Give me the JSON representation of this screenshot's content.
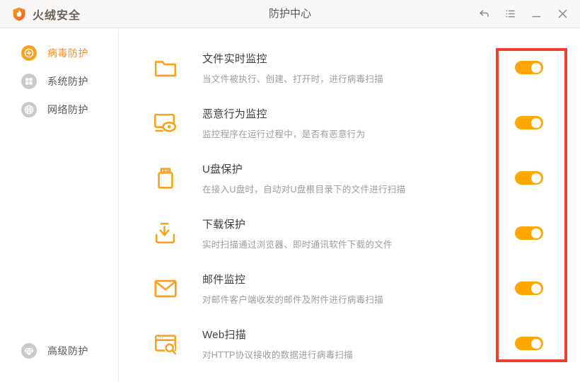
{
  "window": {
    "brand": "火绒安全",
    "title": "防护中心"
  },
  "titlebar": {
    "icons": [
      "undo-icon",
      "menu-list-icon",
      "minimize-icon",
      "close-icon"
    ]
  },
  "sidebar": {
    "items": [
      {
        "label": "病毒防护",
        "icon": "virus-protection-icon",
        "active": true
      },
      {
        "label": "系统防护",
        "icon": "system-protection-icon",
        "active": false
      },
      {
        "label": "网络防护",
        "icon": "network-protection-icon",
        "active": false
      }
    ],
    "bottom_item": {
      "label": "高级防护",
      "icon": "advanced-protection-icon",
      "active": false
    }
  },
  "main": {
    "rows": [
      {
        "icon": "folder-icon",
        "title": "文件实时监控",
        "desc": "当文件被执行、创建、打开时，进行病毒扫描",
        "toggle": "on"
      },
      {
        "icon": "behavior-monitor-icon",
        "title": "恶意行为监控",
        "desc": "监控程序在运行过程中，是否有恶意行为",
        "toggle": "on"
      },
      {
        "icon": "usb-drive-icon",
        "title": "U盘保护",
        "desc": "在接入U盘时，自动对U盘根目录下的文件进行扫描",
        "toggle": "on"
      },
      {
        "icon": "download-icon",
        "title": "下载保护",
        "desc": "实时扫描通过浏览器、即时通讯软件下载的文件",
        "toggle": "on"
      },
      {
        "icon": "mail-icon",
        "title": "邮件监控",
        "desc": "对邮件客户端收发的邮件及附件进行病毒扫描",
        "toggle": "on"
      },
      {
        "icon": "web-scan-icon",
        "title": "Web扫描",
        "desc": "对HTTP协议接收的数据进行病毒扫描",
        "toggle": "on"
      }
    ]
  },
  "colors": {
    "accent": "#F9A11B",
    "toggle_on": "#FFA602",
    "annotation_red": "#F43B30",
    "active_text": "#F78B1F",
    "badge_gray": "#C9C9C9"
  },
  "annotation": {
    "type": "highlight-rectangle",
    "target": "toggle-column"
  }
}
